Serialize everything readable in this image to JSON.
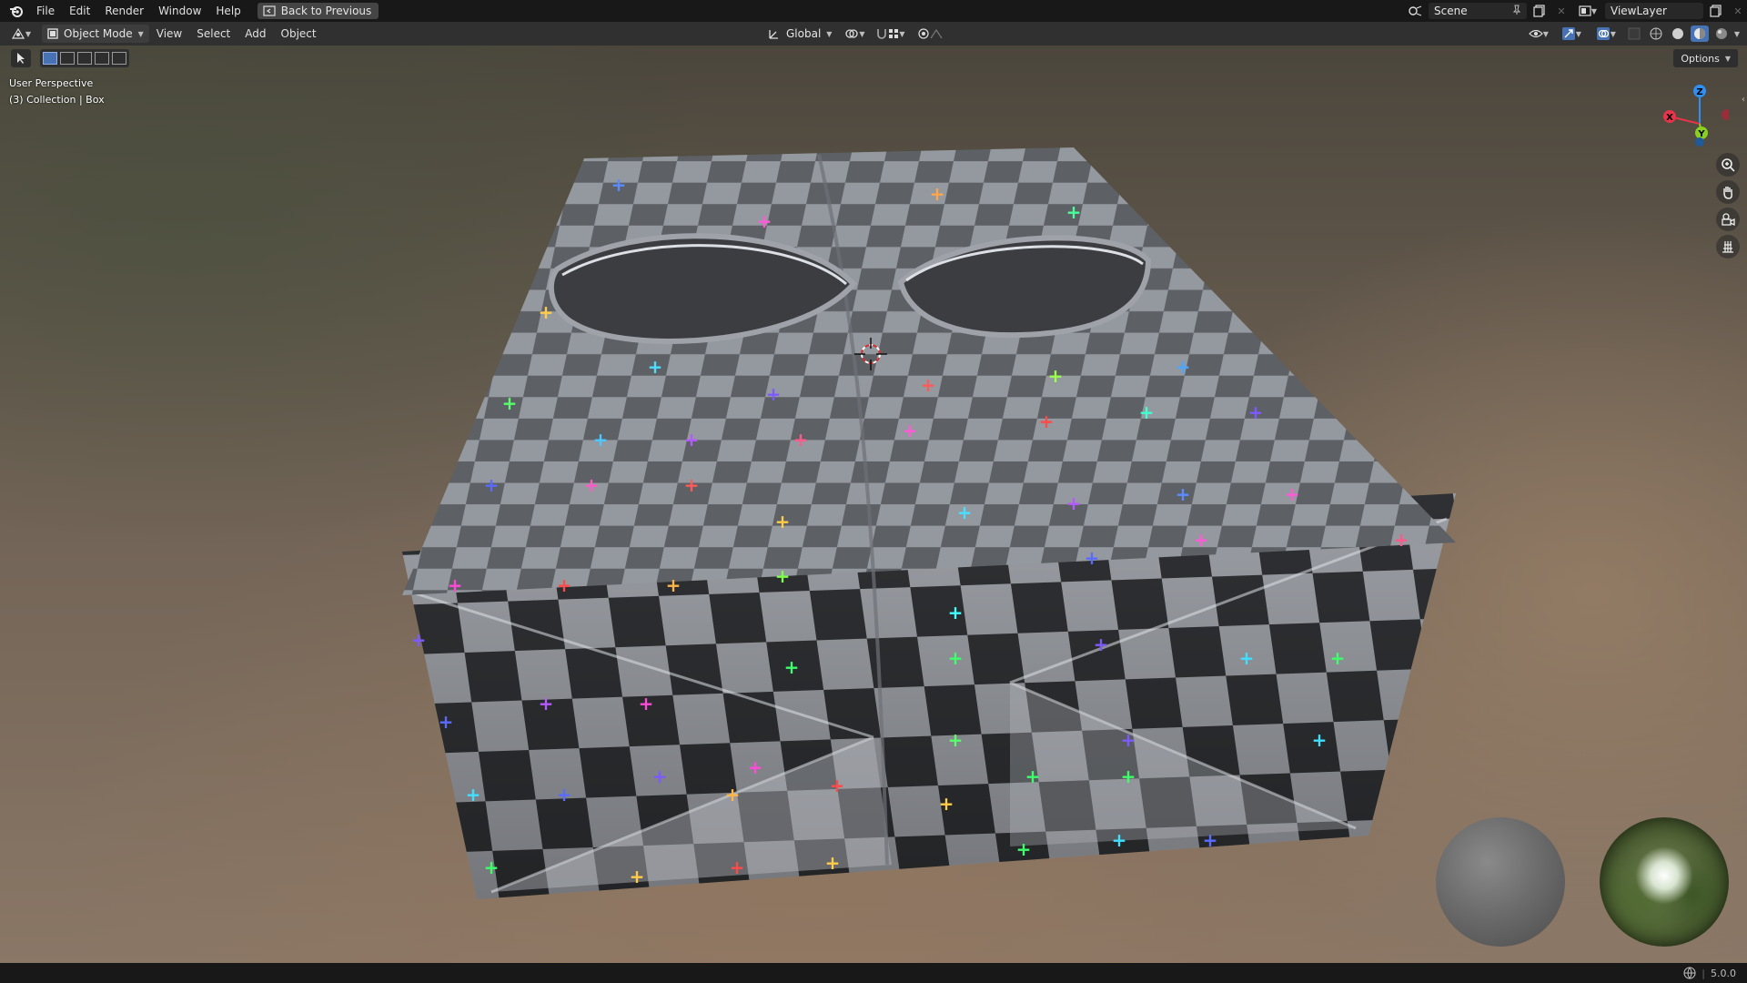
{
  "menubar": {
    "items": [
      "File",
      "Edit",
      "Render",
      "Window",
      "Help"
    ],
    "back_button": "Back to Previous",
    "scene_name": "Scene",
    "view_layer": "ViewLayer"
  },
  "header": {
    "mode": "Object Mode",
    "menus": [
      "View",
      "Select",
      "Add",
      "Object"
    ],
    "transform_orientation": "Global"
  },
  "viewport": {
    "perspective_label": "User Perspective",
    "collection_label": "(3) Collection | Box",
    "options_label": "Options",
    "gizmo_axes": {
      "x": "X",
      "y": "Y",
      "z": "Z"
    },
    "colors": {
      "x_axis": "#e8344a",
      "y_axis": "#8ad11f",
      "z_axis": "#2f8ff2",
      "select_active": "#4772b3"
    }
  },
  "statusbar": {
    "version": "5.0.0"
  },
  "icons": [
    "blender-logo-icon",
    "back-icon",
    "scene-icon",
    "pin-icon",
    "new-scene-icon",
    "view-layer-icon",
    "editor-type-icon",
    "object-mode-icon",
    "orientation-icon",
    "pivot-icon",
    "snap-icon",
    "proportional-icon",
    "overlay-icon",
    "gizmo-icon",
    "xray-icon",
    "shading-wire-icon",
    "shading-solid-icon",
    "shading-material-icon",
    "shading-render-icon",
    "zoom-icon",
    "hand-icon",
    "camera-icon",
    "grid-icon",
    "select-tool-icon",
    "globe-icon"
  ]
}
